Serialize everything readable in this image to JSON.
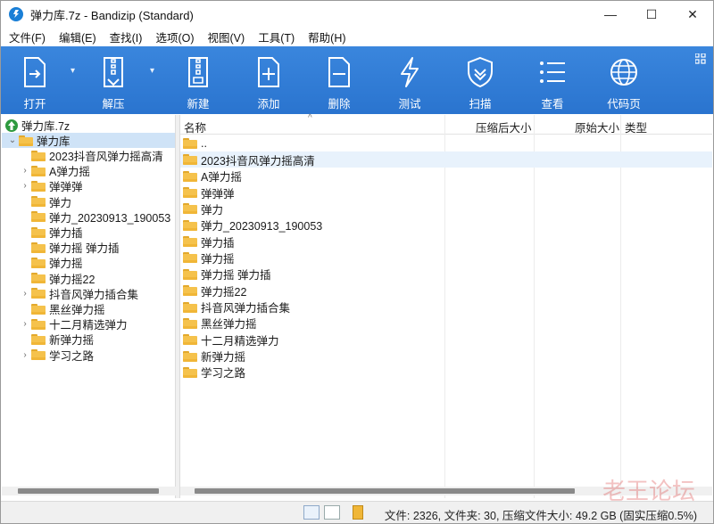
{
  "window": {
    "title": "弹力库.7z - Bandizip (Standard)",
    "minimize_glyph": "—",
    "maximize_glyph": "☐",
    "close_glyph": "✕"
  },
  "menu": [
    "文件(F)",
    "编辑(E)",
    "查找(I)",
    "选项(O)",
    "视图(V)",
    "工具(T)",
    "帮助(H)"
  ],
  "toolbar": {
    "open": "打开",
    "extract": "解压",
    "new": "新建",
    "add": "添加",
    "delete": "删除",
    "test": "测试",
    "scan": "扫描",
    "view": "查看",
    "homepage": "代码页"
  },
  "tree": {
    "root": "弹力库.7z",
    "folder": "弹力库",
    "children": [
      {
        "label": "2023抖音风弹力摇高清",
        "expandable": false
      },
      {
        "label": "A弹力摇",
        "expandable": true
      },
      {
        "label": "弹弹弹",
        "expandable": true
      },
      {
        "label": "弹力",
        "expandable": false
      },
      {
        "label": "弹力_20230913_190053",
        "expandable": false
      },
      {
        "label": "弹力插",
        "expandable": false
      },
      {
        "label": "弹力摇 弹力插",
        "expandable": false
      },
      {
        "label": "弹力摇",
        "expandable": false
      },
      {
        "label": "弹力摇22",
        "expandable": false
      },
      {
        "label": "抖音风弹力插合集",
        "expandable": true
      },
      {
        "label": "黑丝弹力摇",
        "expandable": false
      },
      {
        "label": "十二月精选弹力",
        "expandable": true
      },
      {
        "label": "新弹力摇",
        "expandable": false
      },
      {
        "label": "学习之路",
        "expandable": true
      }
    ]
  },
  "columns": {
    "name": "名称",
    "packed": "压缩后大小",
    "original": "原始大小",
    "type": "类型"
  },
  "files": [
    "..",
    "2023抖音风弹力摇高清",
    "A弹力摇",
    "弹弹弹",
    "弹力",
    "弹力_20230913_190053",
    "弹力插",
    "弹力摇",
    "弹力摇 弹力插",
    "弹力摇22",
    "抖音风弹力插合集",
    "黑丝弹力摇",
    "十二月精选弹力",
    "新弹力摇",
    "学习之路"
  ],
  "status": {
    "text": "文件: 2326, 文件夹: 30, 压缩文件大小: 49.2 GB (固实压缩0.5%)"
  },
  "watermark": "老王论坛",
  "colors": {
    "toolbar": "#2c7ad6",
    "selection": "#cfe3f7",
    "folder": "#f5c24c"
  }
}
